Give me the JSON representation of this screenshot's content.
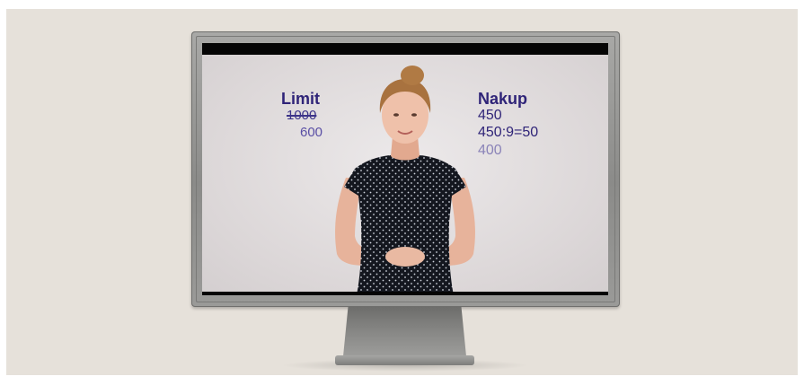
{
  "video": {
    "limit": {
      "title": "Limit",
      "old_value": "1000",
      "new_value": "600"
    },
    "nakup": {
      "title": "Nakup",
      "line1": "450",
      "line2": "450:9=50",
      "line3": "400"
    }
  },
  "colors": {
    "background": "#e6e1da",
    "monitor_frame": "#9a9a98",
    "screen_background": "#e3dfe0",
    "ink": "#2f2478"
  }
}
